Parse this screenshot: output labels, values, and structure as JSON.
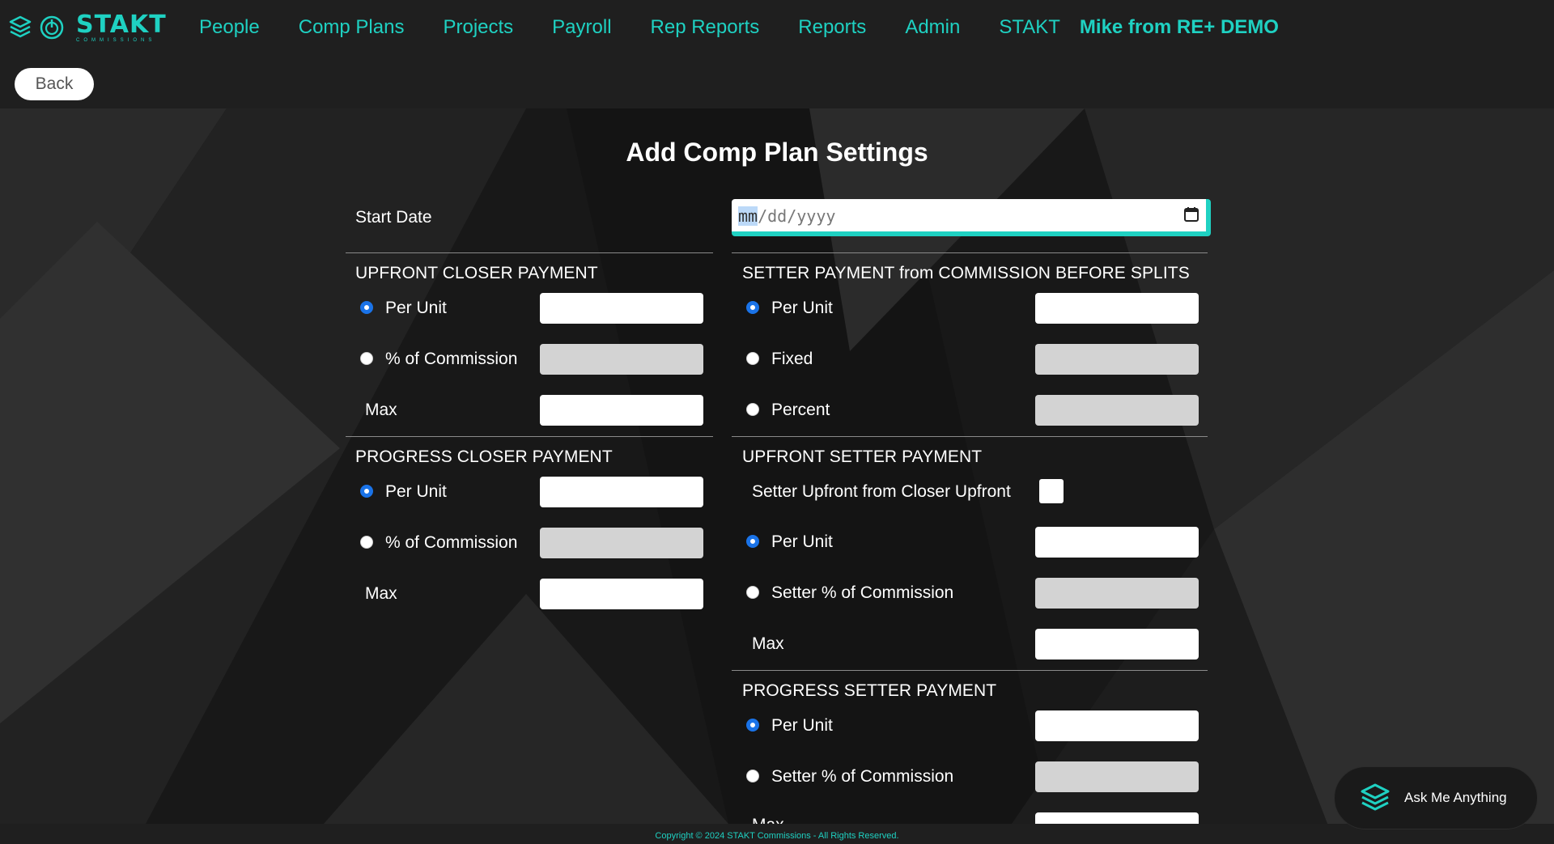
{
  "brand": {
    "name": "STAKT",
    "subtitle": "COMMISSIONS"
  },
  "nav": {
    "items": [
      "People",
      "Comp Plans",
      "Projects",
      "Payroll",
      "Rep Reports",
      "Reports",
      "Admin",
      "STAKT"
    ],
    "user": "Mike from  RE+ DEMO"
  },
  "back_label": "Back",
  "page_title": "Add Comp Plan Settings",
  "start_date": {
    "label": "Start Date",
    "mm": "mm",
    "rest": "/dd/yyyy"
  },
  "upfront_closer": {
    "title": "UPFRONT CLOSER PAYMENT",
    "options": [
      "Per Unit",
      "% of Commission"
    ],
    "max_label": "Max"
  },
  "progress_closer": {
    "title": "PROGRESS CLOSER PAYMENT",
    "options": [
      "Per Unit",
      "% of Commission"
    ],
    "max_label": "Max"
  },
  "setter_before_splits": {
    "title": "SETTER PAYMENT from COMMISSION BEFORE SPLITS",
    "options": [
      "Per Unit",
      "Fixed",
      "Percent"
    ]
  },
  "upfront_setter": {
    "title": "UPFRONT SETTER PAYMENT",
    "checkbox_label": "Setter Upfront from Closer Upfront",
    "options": [
      "Per Unit",
      "Setter % of Commission"
    ],
    "max_label": "Max"
  },
  "progress_setter": {
    "title": "PROGRESS SETTER PAYMENT",
    "options": [
      "Per Unit",
      "Setter % of Commission"
    ],
    "max_label": "Max"
  },
  "footer": "Copyright © 2024 STAKT Commissions - All Rights Reserved.",
  "ama_label": "Ask Me Anything",
  "colors": {
    "accent": "#1fd1c2",
    "radio_selected": "#1a73e8"
  }
}
